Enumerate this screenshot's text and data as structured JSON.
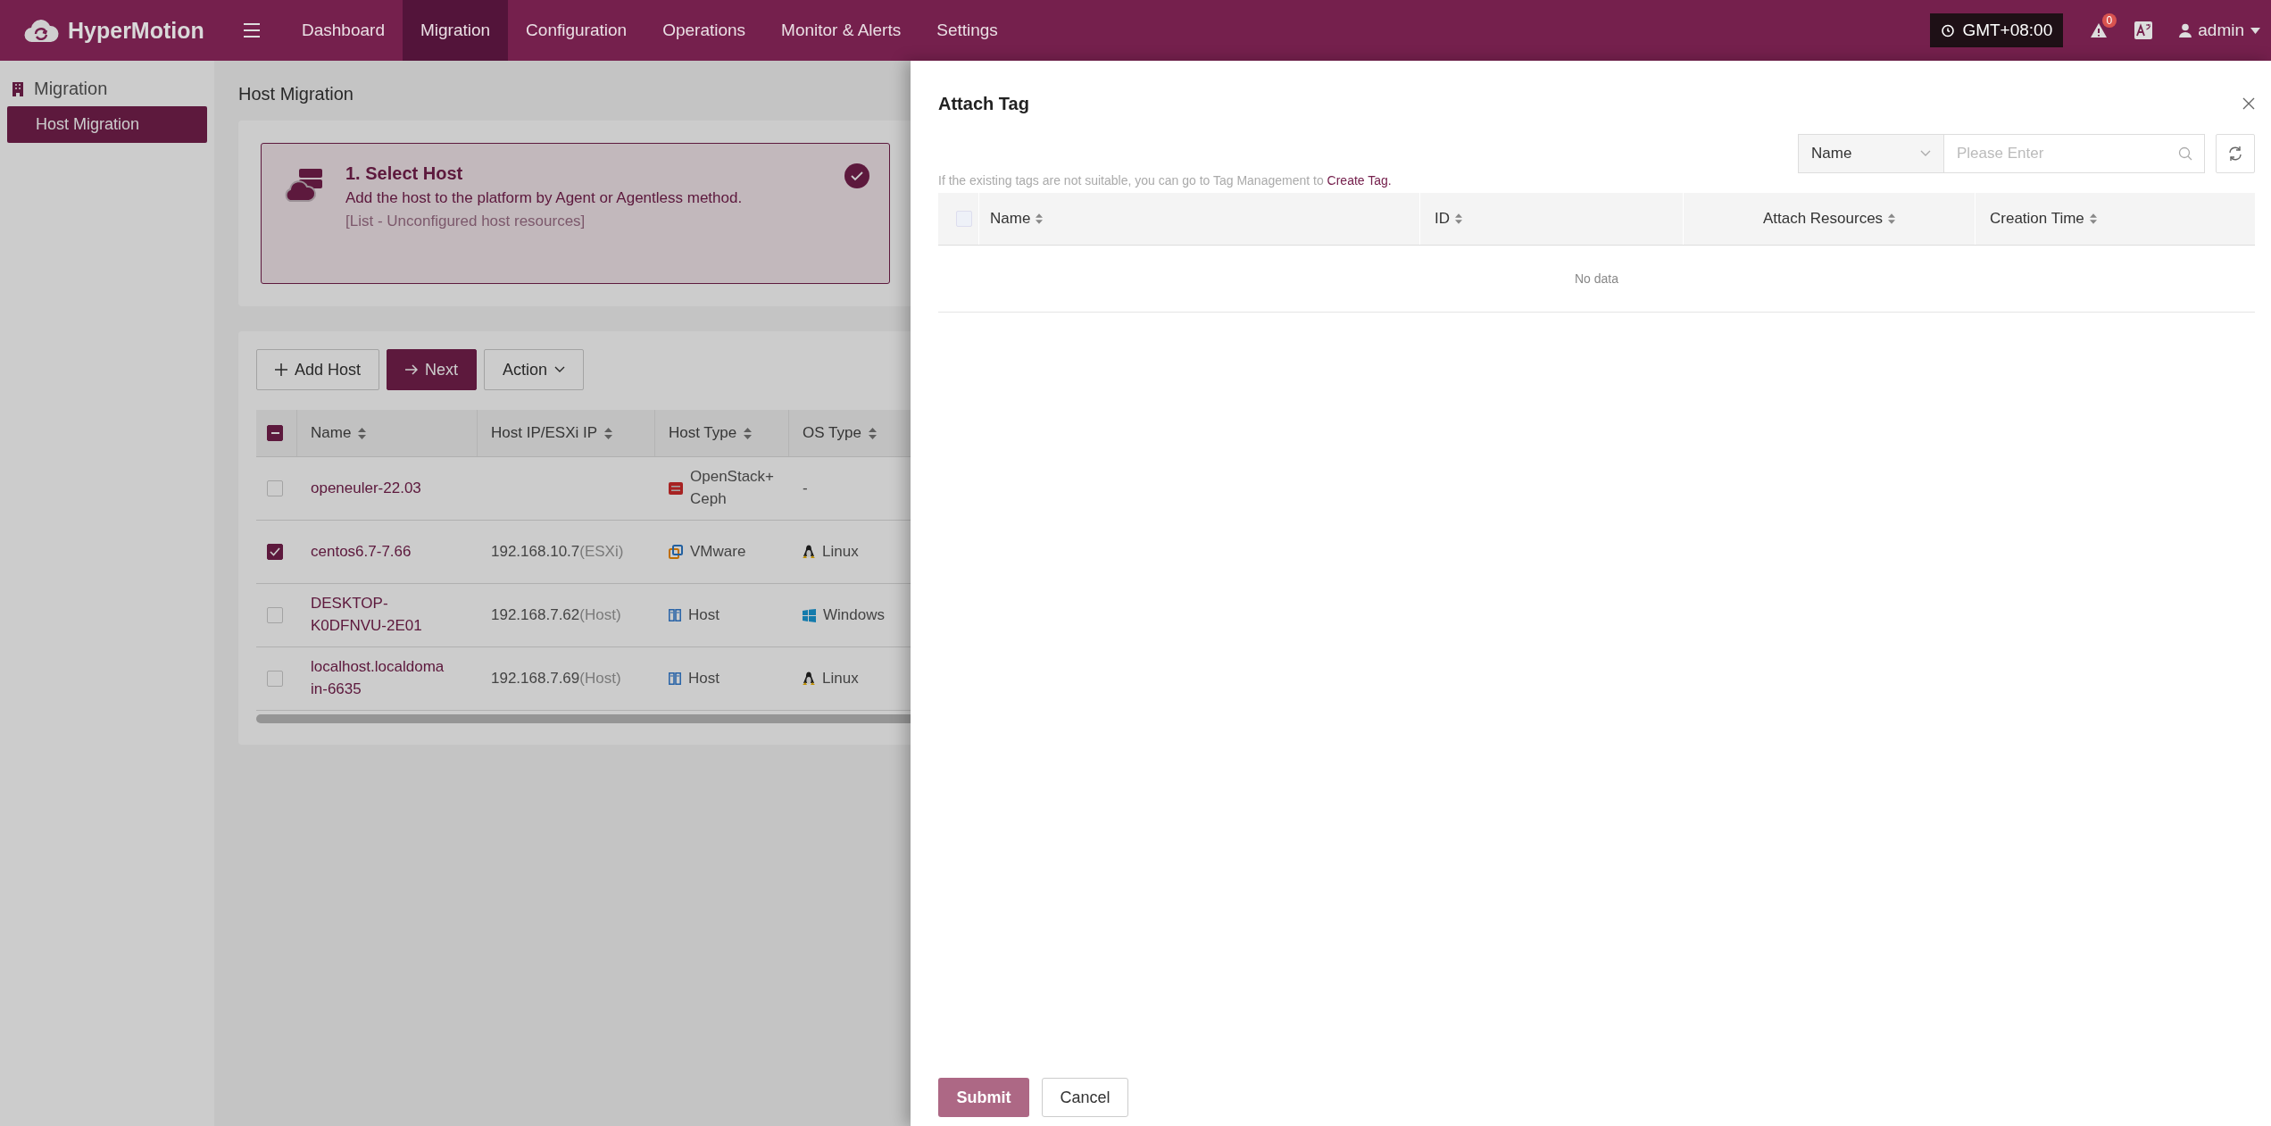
{
  "app": {
    "name": "HyperMotion"
  },
  "nav": [
    {
      "label": "Dashboard",
      "selected": false
    },
    {
      "label": "Migration",
      "selected": true
    },
    {
      "label": "Configuration",
      "selected": false
    },
    {
      "label": "Operations",
      "selected": false
    },
    {
      "label": "Monitor & Alerts",
      "selected": false
    },
    {
      "label": "Settings",
      "selected": false
    }
  ],
  "header": {
    "timezone": "GMT+08:00",
    "alert_count": "0",
    "user": "admin"
  },
  "sidebar": {
    "section": "Migration",
    "items": [
      {
        "label": "Host Migration",
        "selected": true
      }
    ]
  },
  "page_title": "Host Migration",
  "step": {
    "title": "1. Select Host",
    "description": "Add the host to the platform by Agent or Agentless method.",
    "note": "[List - Unconfigured host resources]",
    "done": true
  },
  "toolbar": {
    "add": "Add Host",
    "next": "Next",
    "action": "Action"
  },
  "host_table": {
    "select_all": {
      "indeterminate": true
    },
    "columns": [
      "Name",
      "Host IP/ESXi IP",
      "Host Type",
      "OS Type"
    ],
    "rows": [
      {
        "checked": false,
        "name": "openeuler-22.03",
        "ip": "",
        "ip_suffix": "",
        "host_type": {
          "kind": "openstack",
          "text": "OpenStack+ Ceph"
        },
        "os": {
          "text": "-"
        }
      },
      {
        "checked": true,
        "name": "centos6.7-7.66",
        "ip": "192.168.10.7",
        "ip_suffix": "(ESXi)",
        "host_type": {
          "kind": "vmware",
          "text": "VMware"
        },
        "os": {
          "kind": "linux",
          "text": "Linux"
        }
      },
      {
        "checked": false,
        "name": "DESKTOP-K0DFNVU-2E01",
        "ip": "192.168.7.62",
        "ip_suffix": "(Host)",
        "host_type": {
          "kind": "host",
          "text": "Host"
        },
        "os": {
          "kind": "windows",
          "text": "Windows"
        }
      },
      {
        "checked": false,
        "name": "localhost.localdomain-6635",
        "ip": "192.168.7.69",
        "ip_suffix": "(Host)",
        "host_type": {
          "kind": "host",
          "text": "Host"
        },
        "os": {
          "kind": "linux",
          "text": "Linux"
        }
      }
    ]
  },
  "drawer": {
    "title": "Attach Tag",
    "filter": {
      "field": "Name",
      "placeholder": "Please Enter"
    },
    "hint": "If the existing tags are not suitable, you can go to Tag Management to ",
    "hint_link": "Create Tag.",
    "table": {
      "select_all": {
        "checked": false
      },
      "columns": [
        "Name",
        "ID",
        "Attach Resources",
        "Creation Time"
      ],
      "empty": "No data"
    },
    "buttons": {
      "submit": "Submit",
      "cancel": "Cancel"
    }
  }
}
